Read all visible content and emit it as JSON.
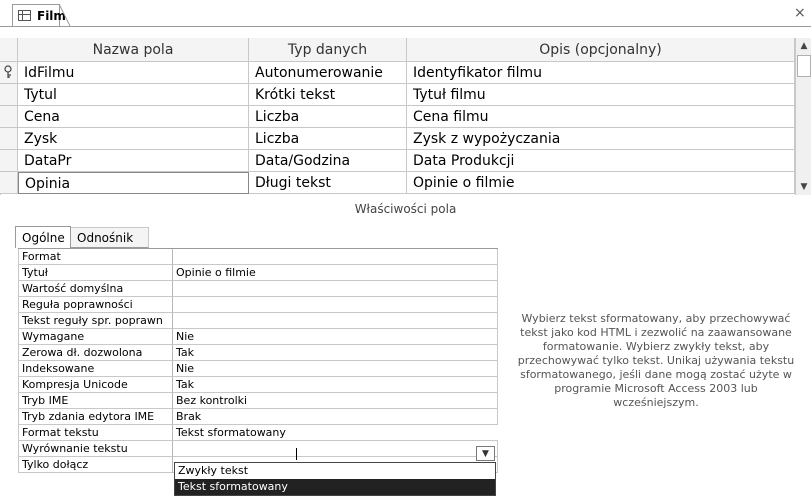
{
  "tab": {
    "title": "Film",
    "close_glyph": "×"
  },
  "grid": {
    "headers": [
      "Nazwa pola",
      "Typ danych",
      "Opis (opcjonalny)"
    ],
    "rows": [
      {
        "name": "IdFilmu",
        "type": "Autonumerowanie",
        "desc": "Identyfikator filmu",
        "key": true
      },
      {
        "name": "Tytul",
        "type": "Krótki tekst",
        "desc": "Tytuł filmu"
      },
      {
        "name": "Cena",
        "type": "Liczba",
        "desc": "Cena filmu"
      },
      {
        "name": "Zysk",
        "type": "Liczba",
        "desc": "Zysk z wypożyczania"
      },
      {
        "name": "DataPr",
        "type": "Data/Godzina",
        "desc": "Data Produkcji"
      },
      {
        "name": "Opinia",
        "type": "Długi tekst",
        "desc": "Opinie o filmie"
      }
    ]
  },
  "properties": {
    "section_title": "Właściwości pola",
    "tabs": [
      "Ogólne",
      "Odnośnik"
    ],
    "rows": [
      {
        "label": "Format",
        "value": ""
      },
      {
        "label": "Tytuł",
        "value": "Opinie o filmie"
      },
      {
        "label": "Wartość domyślna",
        "value": ""
      },
      {
        "label": "Reguła poprawności",
        "value": ""
      },
      {
        "label": "Tekst reguły spr. poprawn",
        "value": ""
      },
      {
        "label": "Wymagane",
        "value": "Nie"
      },
      {
        "label": "Zerowa dł. dozwolona",
        "value": "Tak"
      },
      {
        "label": "Indeksowane",
        "value": "Nie"
      },
      {
        "label": "Kompresja Unicode",
        "value": "Tak"
      },
      {
        "label": "Tryb IME",
        "value": "Bez kontrolki"
      },
      {
        "label": "Tryb zdania edytora IME",
        "value": "Brak"
      },
      {
        "label": "Format tekstu",
        "value": "Tekst sformatowany"
      },
      {
        "label": "Wyrównanie tekstu",
        "value": ""
      },
      {
        "label": "Tylko dołącz",
        "value": ""
      }
    ],
    "dropdown_options": [
      "Zwykły tekst",
      "Tekst sformatowany"
    ],
    "selected_option": "Tekst sformatowany"
  },
  "help_text": "Wybierz tekst sformatowany, aby przechowywać tekst jako kod HTML i zezwolić na zaawansowane formatowanie. Wybierz zwykły tekst, aby przechowywać tylko tekst. Unikaj używania tekstu sformatowanego, jeśli dane mogą zostać użyte w programie Microsoft Access 2003 lub wcześniejszym.",
  "icons": {
    "table": "table-icon",
    "key": "key-icon",
    "close": "close-icon",
    "dropdown": "chevron-down-icon"
  }
}
